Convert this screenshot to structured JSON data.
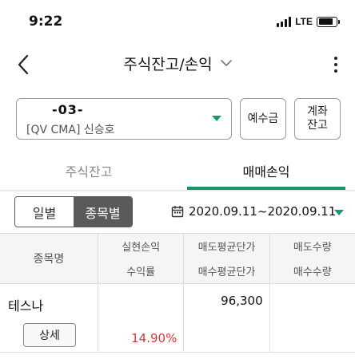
{
  "status": {
    "time": "9:22",
    "network": "LTE",
    "battery_level": 0.85
  },
  "header": {
    "title": "주식잔고/손익",
    "back_icon": "chevron-left-icon",
    "more_icon": "more-vertical-icon"
  },
  "account": {
    "number": "-03-",
    "name": "[QV CMA]  신승호",
    "deposit_label": "예수금",
    "account_label": "계좌\n잔고",
    "accent": "#1a9a6c"
  },
  "tabs": [
    {
      "label": "주식잔고",
      "active": false
    },
    {
      "label": "매매손익",
      "active": true
    }
  ],
  "filter": {
    "segments": [
      {
        "label": "일별",
        "active": false
      },
      {
        "label": "종목별",
        "active": true
      }
    ],
    "date_range": "2020.09.11~2020.09.11"
  },
  "table": {
    "headers": {
      "name": "종목명",
      "col1": [
        "실현손익",
        "수익률"
      ],
      "col2": [
        "매도평균단가",
        "매수평균단가"
      ],
      "col3": [
        "매도수량",
        "매수수량"
      ]
    },
    "rows": [
      {
        "name": "테스나",
        "detail_label": "상세",
        "realized_pnl": "",
        "return_rate": "14.90%",
        "sell_avg_price": "96,300",
        "buy_avg_price": "",
        "sell_qty": "",
        "buy_qty": ""
      }
    ]
  }
}
